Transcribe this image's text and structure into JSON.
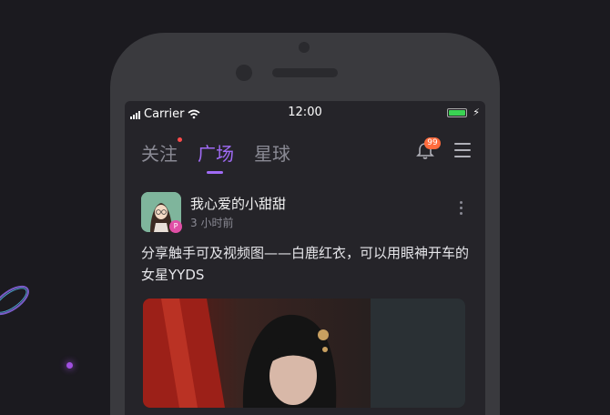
{
  "status_bar": {
    "carrier": "Carrier",
    "time": "12:00",
    "battery_charging_icon": "lightning-icon"
  },
  "tabs": [
    {
      "label": "关注",
      "active": false,
      "has_dot": true
    },
    {
      "label": "广场",
      "active": true,
      "has_dot": false
    },
    {
      "label": "星球",
      "active": false,
      "has_dot": false
    }
  ],
  "header_actions": {
    "notifications_icon": "bell-icon",
    "notifications_count": "99",
    "menu_icon": "hamburger-menu-icon"
  },
  "post": {
    "username": "我心爱的小甜甜",
    "time_ago": "3 小时前",
    "avatar_badge": "P",
    "text": "分享触手可及视频图——白鹿红衣，可以用眼神开车的女星YYDS"
  },
  "colors": {
    "accent": "#a06bf5",
    "badge": "#ff6b3d",
    "tab_dot": "#ff4b4b",
    "battery": "#3ad353"
  }
}
